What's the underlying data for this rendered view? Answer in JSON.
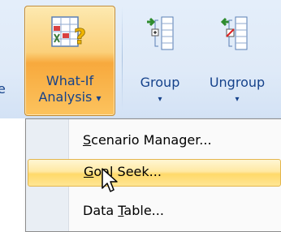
{
  "ribbon": {
    "partial_label": "e",
    "what_if": {
      "line1": "What-If",
      "line2": "Analysis",
      "arrow": "▾",
      "icon": "what-if-analysis-icon"
    },
    "group": {
      "label": "Group",
      "arrow": "▾",
      "icon": "group-outline-icon"
    },
    "ungroup": {
      "label": "Ungroup",
      "arrow": "▾",
      "icon": "ungroup-outline-icon"
    }
  },
  "menu": {
    "items": [
      {
        "pre": "",
        "accel": "S",
        "post": "cenario Manager...",
        "state": "normal"
      },
      {
        "pre": "",
        "accel": "G",
        "post": "oal Seek...",
        "state": "hover"
      },
      {
        "pre": "Data ",
        "accel": "T",
        "post": "able...",
        "state": "normal"
      }
    ]
  },
  "colors": {
    "ribbon_text": "#15428b",
    "active_button": "#f7a93d",
    "menu_hover": "#ffd96a"
  }
}
